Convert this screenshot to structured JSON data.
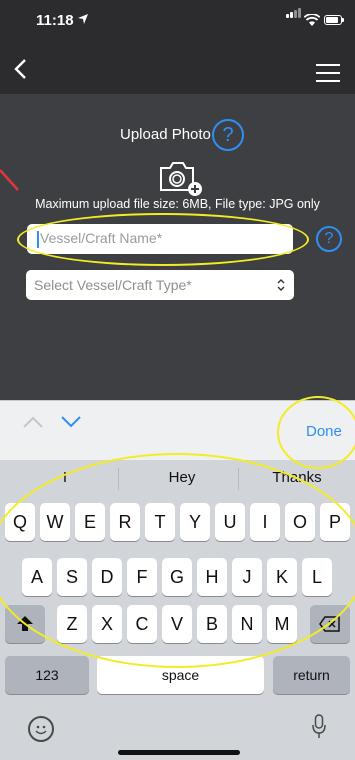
{
  "status_bar": {
    "time": "11:18"
  },
  "form": {
    "upload_label": "Upload Photo",
    "help_symbol": "?",
    "upload_info": "Maximum upload file size: 6MB, File type: JPG only",
    "vessel_name_placeholder": "Vessel/Craft Name*",
    "vessel_type_placeholder": "Select Vessel/Craft Type*"
  },
  "accessory": {
    "done_label": "Done"
  },
  "keyboard": {
    "suggestions": [
      "I",
      "Hey",
      "Thanks"
    ],
    "rows": [
      [
        "Q",
        "W",
        "E",
        "R",
        "T",
        "Y",
        "U",
        "I",
        "O",
        "P"
      ],
      [
        "A",
        "S",
        "D",
        "F",
        "G",
        "H",
        "J",
        "K",
        "L"
      ],
      [
        "Z",
        "X",
        "C",
        "V",
        "B",
        "N",
        "M"
      ]
    ],
    "numbers_label": "123",
    "space_label": "space",
    "return_label": "return"
  },
  "icons": {
    "location": "location-arrow-icon",
    "signal": "signal-bars-icon",
    "wifi": "wifi-icon",
    "battery": "battery-icon",
    "back": "chevron-left-icon",
    "menu": "hamburger-menu-icon",
    "camera": "camera-add-icon",
    "shift": "shift-icon",
    "delete": "backspace-icon",
    "emoji": "emoji-icon",
    "mic": "microphone-icon"
  },
  "colors": {
    "accent": "#2f8ff5",
    "annotation": "#f3ec25",
    "app_bg": "#3e3f42"
  }
}
